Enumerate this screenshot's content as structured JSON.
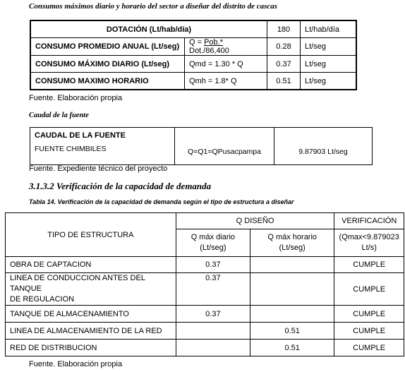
{
  "caption1": "Consumos máximos diario y horario del sector a diseñar del distrito de cascas",
  "table1": {
    "header": {
      "label": "DOTACIÓN (Lt/hab/día)",
      "value": "180",
      "unit": "Lt/hab/día"
    },
    "rows": [
      {
        "label": "CONSUMO PROMEDIO ANUAL (Lt/seg)",
        "formula_pre": "Q = ",
        "formula_link": "Pob.*",
        "formula_post": " Dot./86,400",
        "value": "0.28",
        "unit": "Lt/seg"
      },
      {
        "label": "CONSUMO MÁXIMO DIARIO (Lt/seg)",
        "formula": "Qmd = 1.30 * Q",
        "value": "0.37",
        "unit": "Lt/seg"
      },
      {
        "label": "CONSUMO MAXIMO HORARIO",
        "formula": "Qmh = 1.8* Q",
        "value": "0.51",
        "unit": "Lt/seg"
      }
    ]
  },
  "source1": "Fuente. Elaboración propia",
  "caption2": "Caudal de la fuente",
  "table2": {
    "title": "CAUDAL DE LA FUENTE",
    "name": "FUENTE CHIMBILES",
    "formula": "Q=Q1=QPusacpampa",
    "value": "9.87903 Lt/seg"
  },
  "source2": "Fuente. Expediente técnico del proyecto",
  "heading": "3.1.3.2 Verificación de la capacidad de demanda",
  "caption3": "Tabla 14. Verificación de la capacidad de demanda según el tipo de estructura a diseñar",
  "table3": {
    "col_type": "TIPO DE ESTRUCTURA",
    "col_group": "Q DISEÑO",
    "col_daily_1": "Q máx diario",
    "col_daily_2": "(Lt/seg)",
    "col_hourly_1": "Q máx horario",
    "col_hourly_2": "(Lt/seg)",
    "col_verif": "VERIFICACIÓN",
    "col_verif_sub_1": "(Qmax<9.879023",
    "col_verif_sub_2": "Lt/s)",
    "rows": [
      {
        "type_1": "OBRA DE CAPTACION",
        "type_2": "",
        "daily": "0.37",
        "hourly": "",
        "verif": "CUMPLE"
      },
      {
        "type_1": "LINEA DE CONDUCCION ANTES DEL TANQUE",
        "type_2": "DE REGULACION",
        "daily": "0.37",
        "hourly": "",
        "verif": "CUMPLE"
      },
      {
        "type_1": "TANQUE DE ALMACENAMIENTO",
        "type_2": "",
        "daily": "0.37",
        "hourly": "",
        "verif": "CUMPLE"
      },
      {
        "type_1": "LINEA DE ALMACENAMIENTO DE LA RED",
        "type_2": "",
        "daily": "",
        "hourly": "0.51",
        "verif": "CUMPLE"
      },
      {
        "type_1": "RED DE DISTRIBUCION",
        "type_2": "",
        "daily": "",
        "hourly": "0.51",
        "verif": "CUMPLE"
      }
    ]
  },
  "source3": "Fuente. Elaboración propia"
}
